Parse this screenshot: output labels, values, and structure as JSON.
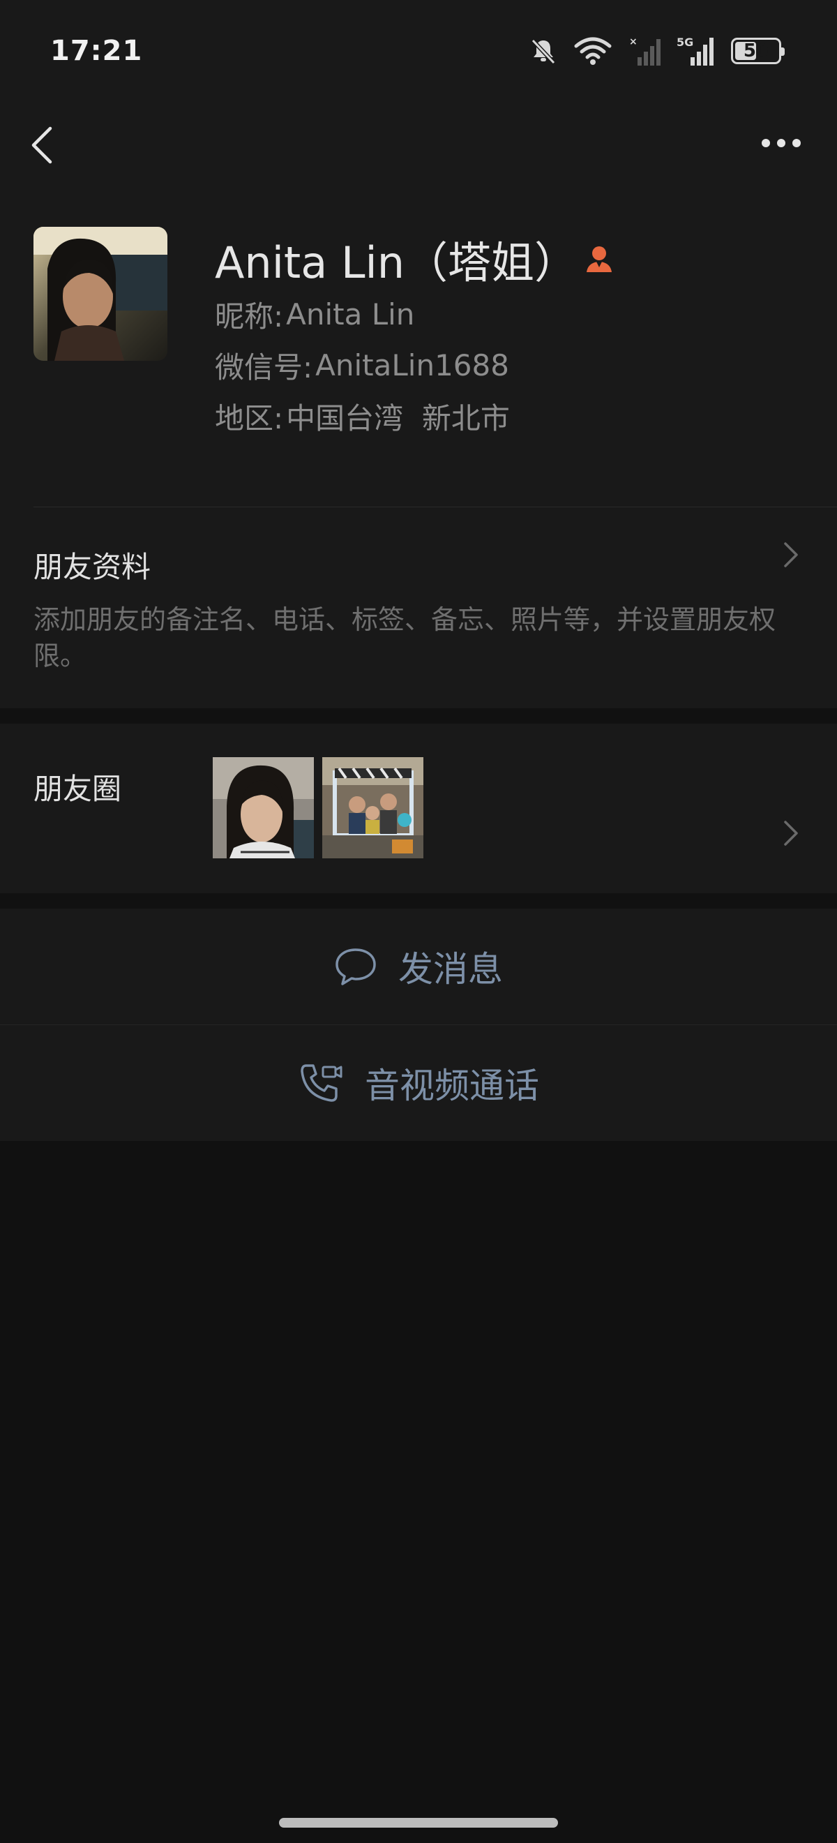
{
  "status_bar": {
    "time": "17:21",
    "network": "5G",
    "battery": "50",
    "battery_level": 0.5,
    "icons": [
      "mute-bell-icon",
      "wifi-icon",
      "no-signal-sim2-icon",
      "signal-5g-icon",
      "battery-icon"
    ]
  },
  "header": {
    "back_icon": "chevron-left-icon",
    "more_icon": "more-dots-icon"
  },
  "profile": {
    "display_name": "Anita Lin（塔姐）",
    "badge_icon": "contact-person-icon",
    "badge_color": "#e8683f",
    "nickname_label": "昵称:",
    "nickname": "Anita Lin",
    "wechat_id_label": "微信号:",
    "wechat_id": "AnitaLin1688",
    "region_label": "地区:",
    "region": "中国台湾  新北市"
  },
  "friend_profile": {
    "title": "朋友资料",
    "description": "添加朋友的备注名、电话、标签、备忘、照片等，并设置朋友权限。"
  },
  "moments": {
    "title": "朋友圈"
  },
  "actions": {
    "message_label": "发消息",
    "message_icon": "chat-bubble-icon",
    "call_label": "音视频通话",
    "call_icon": "phone-video-icon",
    "accent_color": "#7d90a8"
  }
}
